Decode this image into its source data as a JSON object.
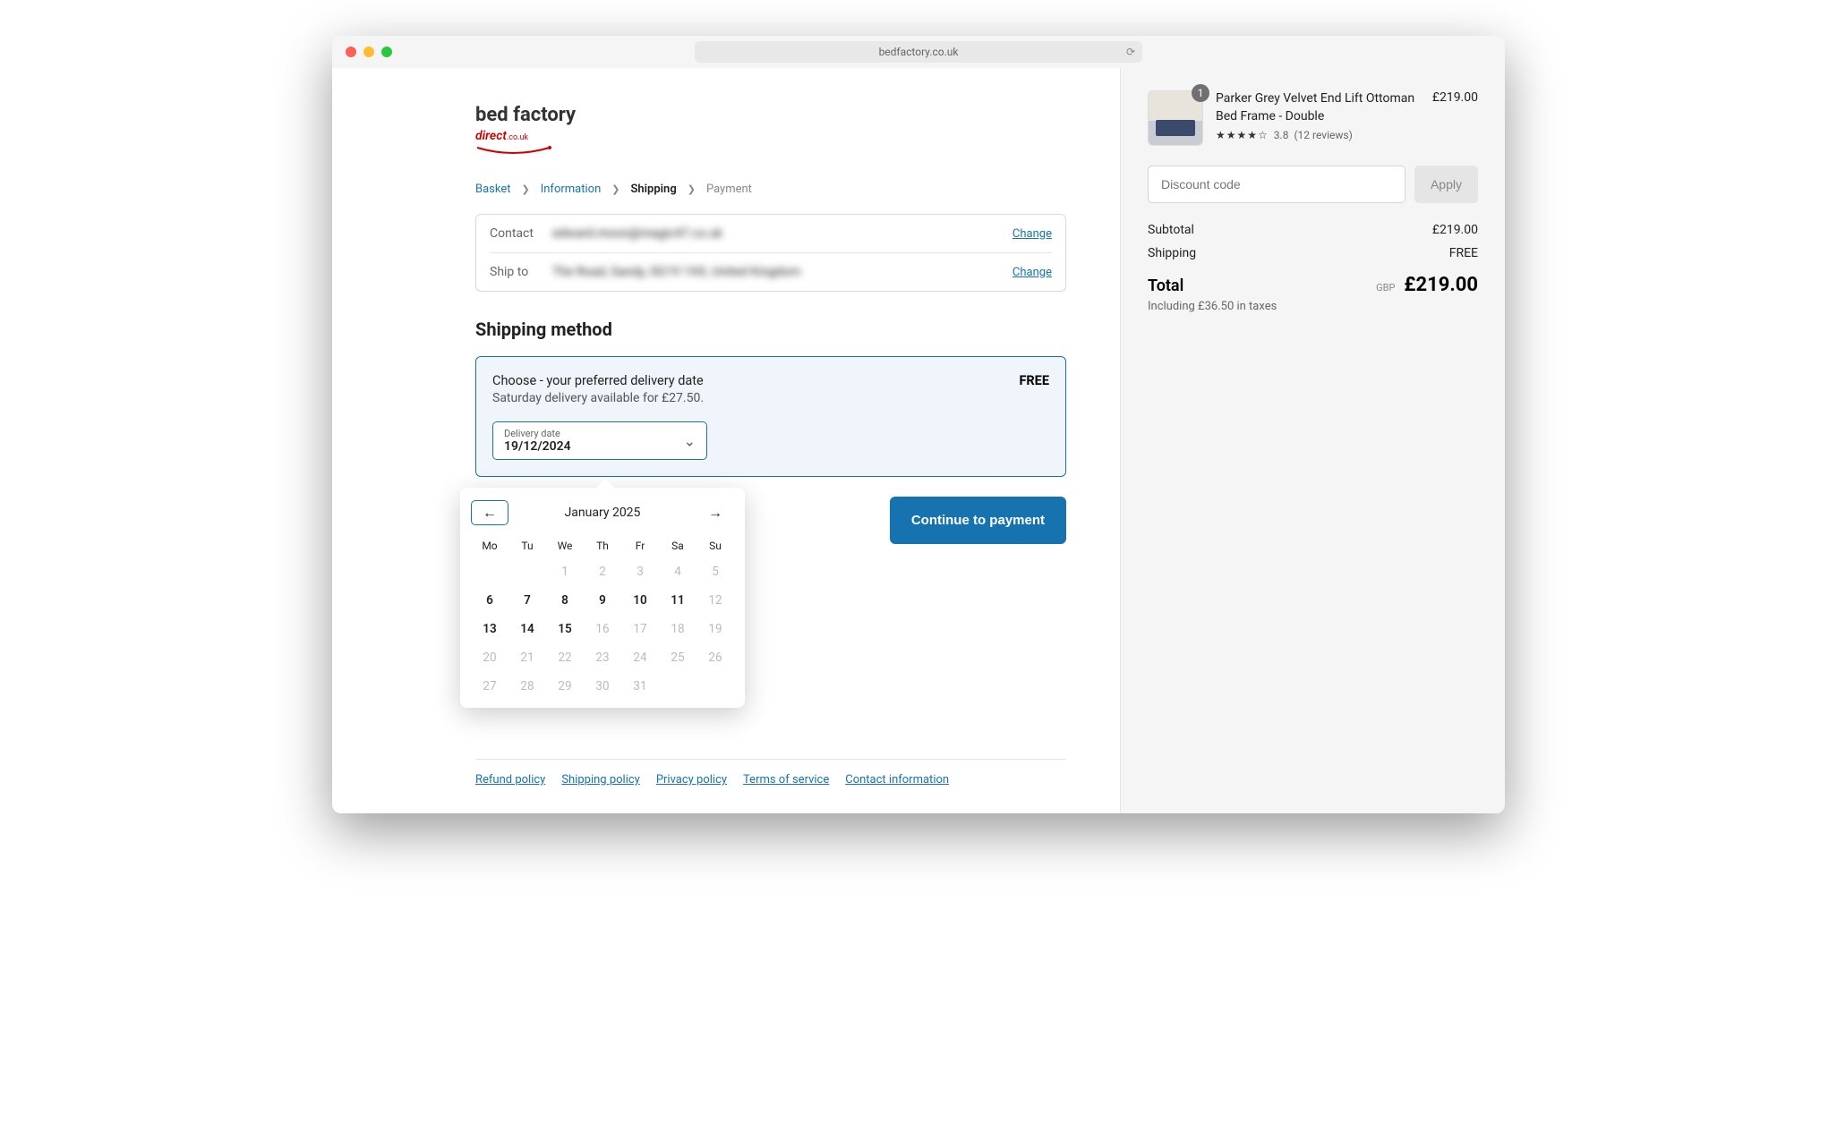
{
  "browser": {
    "url": "bedfactory.co.uk"
  },
  "logo": {
    "line1": "bed factory",
    "line2": "direct",
    "domain": ".co.uk"
  },
  "breadcrumb": {
    "basket": "Basket",
    "information": "Information",
    "shipping": "Shipping",
    "payment": "Payment"
  },
  "info": {
    "contact_label": "Contact",
    "contact_value": "edward.moon@magic47.co.uk",
    "shipto_label": "Ship to",
    "shipto_value": "The Road, Sandy, SG19 1XX, United Kingdom",
    "change": "Change"
  },
  "shipping": {
    "heading": "Shipping method",
    "title": "Choose - your preferred delivery date",
    "subtitle": "Saturday delivery available for £27.50.",
    "price": "FREE",
    "date_label": "Delivery date",
    "date_value": "19/12/2024"
  },
  "calendar": {
    "month": "January 2025",
    "dow": [
      "Mo",
      "Tu",
      "We",
      "Th",
      "Fr",
      "Sa",
      "Su"
    ],
    "days": [
      {
        "n": "",
        "avail": false
      },
      {
        "n": "",
        "avail": false
      },
      {
        "n": "1",
        "avail": false
      },
      {
        "n": "2",
        "avail": false
      },
      {
        "n": "3",
        "avail": false
      },
      {
        "n": "4",
        "avail": false
      },
      {
        "n": "5",
        "avail": false
      },
      {
        "n": "6",
        "avail": true
      },
      {
        "n": "7",
        "avail": true
      },
      {
        "n": "8",
        "avail": true
      },
      {
        "n": "9",
        "avail": true
      },
      {
        "n": "10",
        "avail": true
      },
      {
        "n": "11",
        "avail": true
      },
      {
        "n": "12",
        "avail": false
      },
      {
        "n": "13",
        "avail": true
      },
      {
        "n": "14",
        "avail": true
      },
      {
        "n": "15",
        "avail": true
      },
      {
        "n": "16",
        "avail": false
      },
      {
        "n": "17",
        "avail": false
      },
      {
        "n": "18",
        "avail": false
      },
      {
        "n": "19",
        "avail": false
      },
      {
        "n": "20",
        "avail": false
      },
      {
        "n": "21",
        "avail": false
      },
      {
        "n": "22",
        "avail": false
      },
      {
        "n": "23",
        "avail": false
      },
      {
        "n": "24",
        "avail": false
      },
      {
        "n": "25",
        "avail": false
      },
      {
        "n": "26",
        "avail": false
      },
      {
        "n": "27",
        "avail": false
      },
      {
        "n": "28",
        "avail": false
      },
      {
        "n": "29",
        "avail": false
      },
      {
        "n": "30",
        "avail": false
      },
      {
        "n": "31",
        "avail": false
      }
    ]
  },
  "continue": "Continue to payment",
  "footer": {
    "refund": "Refund policy",
    "shipping": "Shipping policy",
    "privacy": "Privacy policy",
    "terms": "Terms of service",
    "contact": "Contact information"
  },
  "cart": {
    "item": {
      "qty": "1",
      "name": "Parker Grey Velvet End Lift Ottoman Bed Frame - Double",
      "price": "£219.00",
      "rating": "3.8",
      "reviews": "(12 reviews)",
      "stars": "★★★★☆"
    },
    "discount_placeholder": "Discount code",
    "apply": "Apply",
    "subtotal_label": "Subtotal",
    "subtotal_value": "£219.00",
    "shipping_label": "Shipping",
    "shipping_value": "FREE",
    "total_label": "Total",
    "total_currency": "GBP",
    "total_value": "£219.00",
    "tax_note": "Including £36.50 in taxes"
  }
}
